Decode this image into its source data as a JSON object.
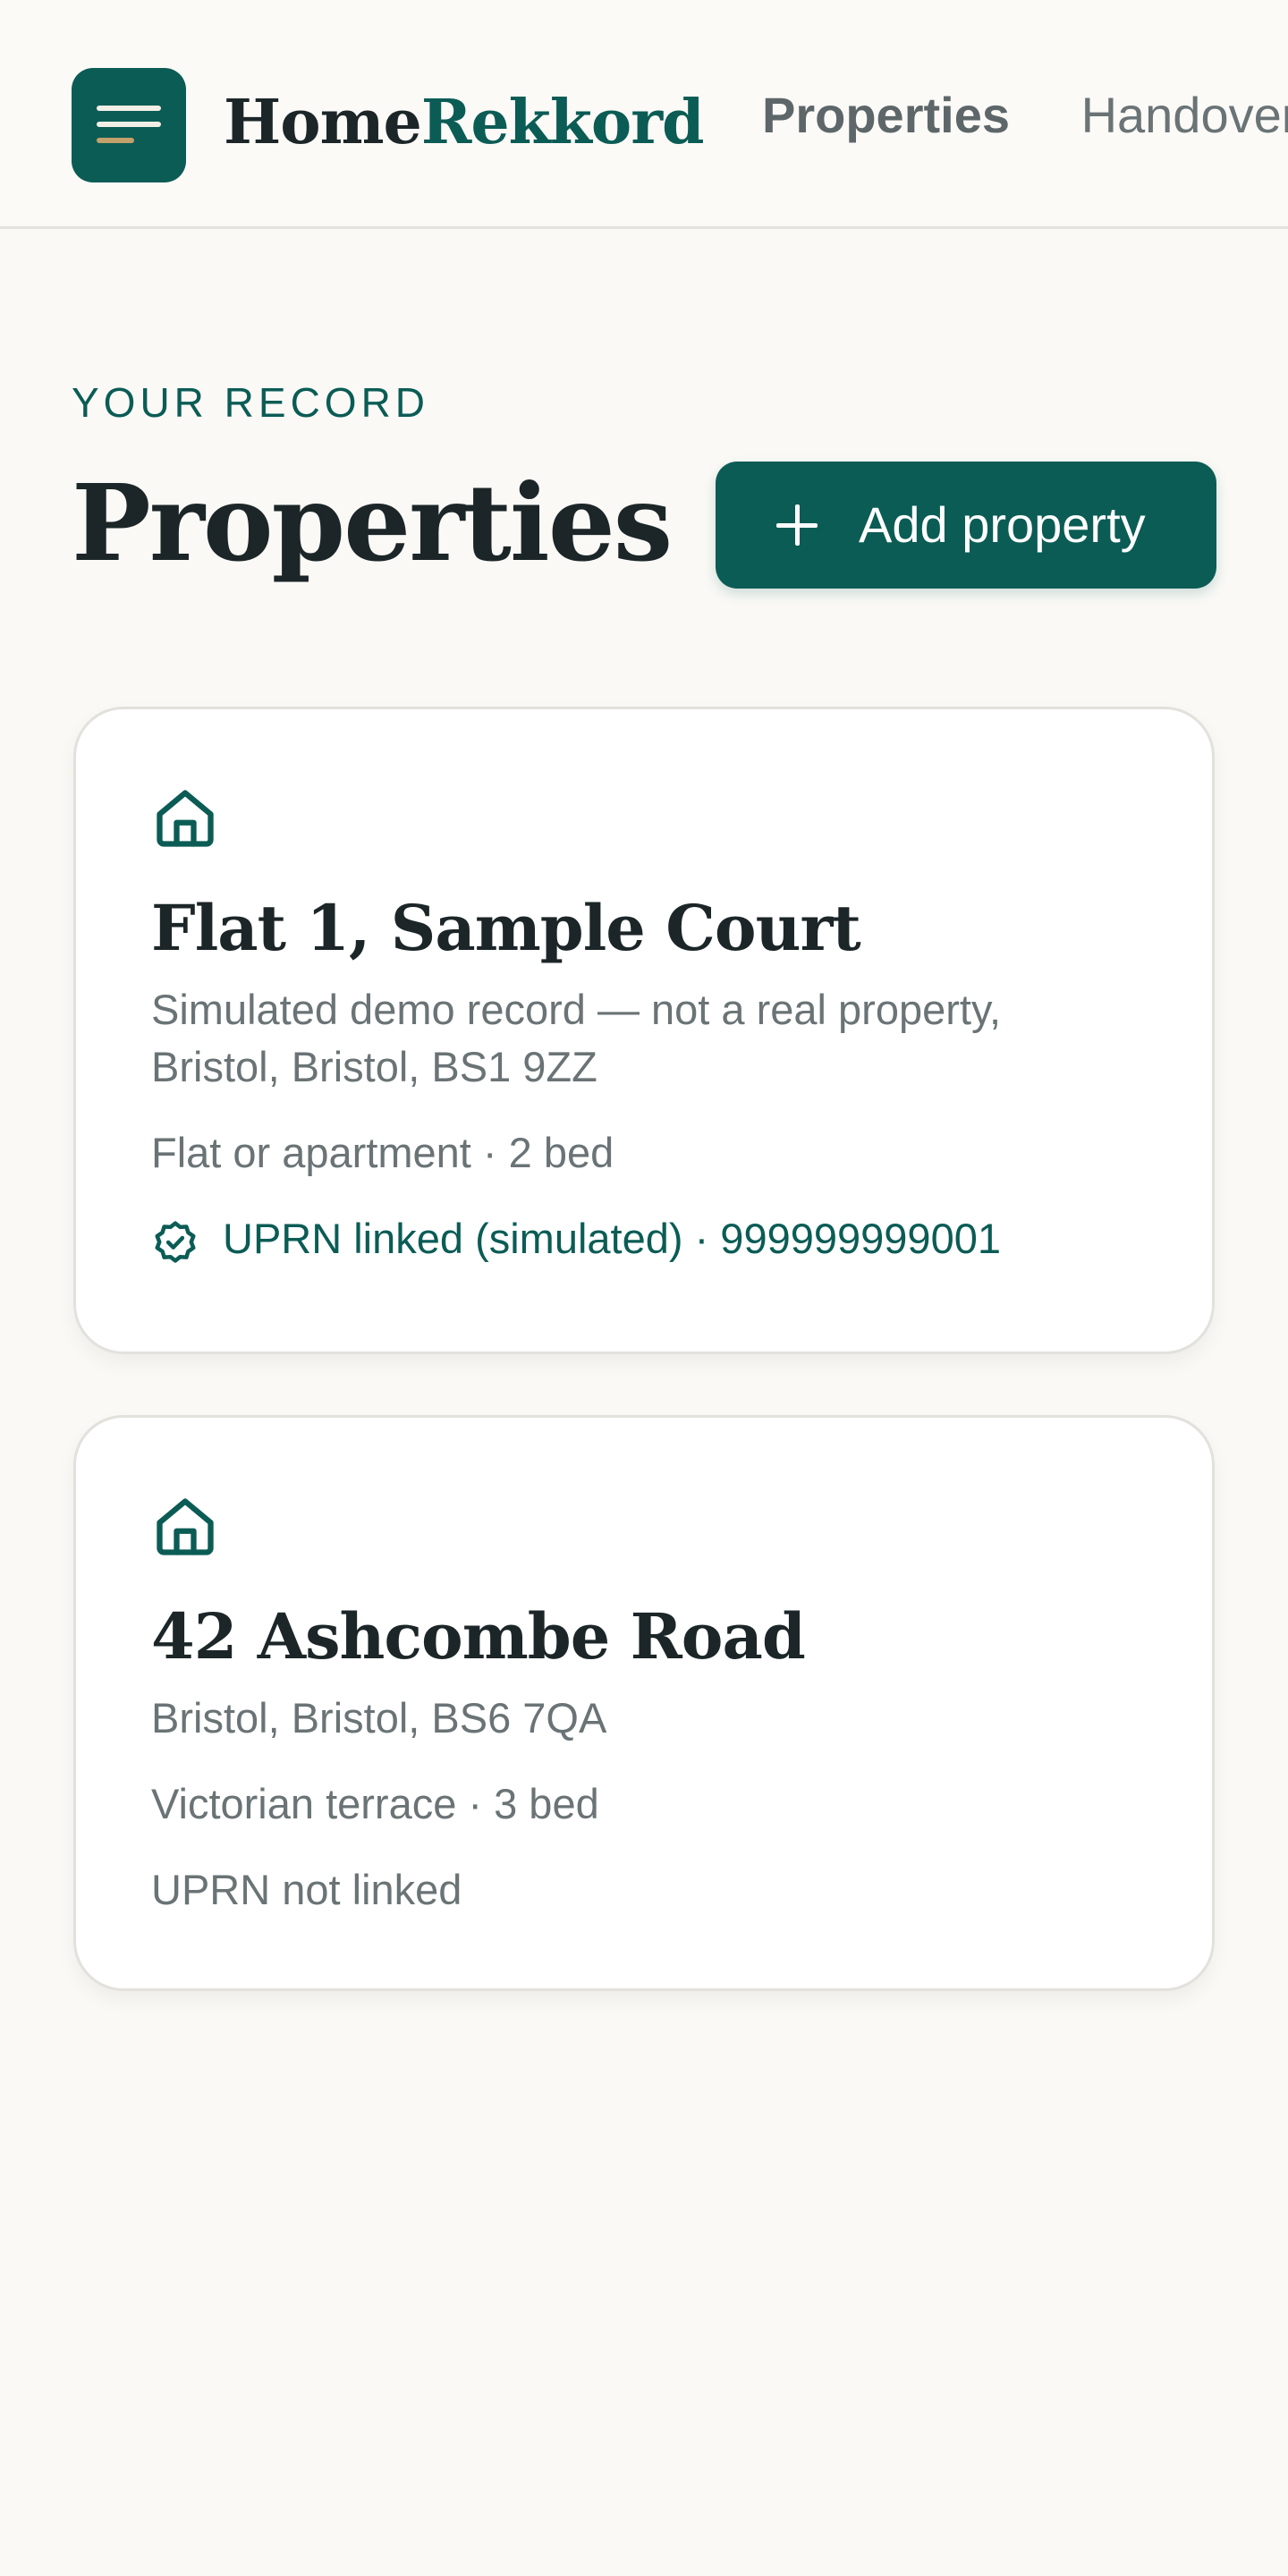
{
  "brand": {
    "name_part1": "Home",
    "name_part2": "Rekkord",
    "menu_icon": "menu-icon"
  },
  "nav": {
    "items": [
      {
        "label": "Properties",
        "active": true
      },
      {
        "label": "Handovers",
        "active": false
      }
    ]
  },
  "page": {
    "eyebrow": "YOUR RECORD",
    "title": "Properties",
    "add_button_label": "Add property",
    "add_button_icon": "plus-icon"
  },
  "properties": [
    {
      "icon": "house-icon",
      "name": "Flat 1, Sample Court",
      "address_line1": "Simulated demo record — not a real property,",
      "address_line2": "Bristol, Bristol, BS1 9ZZ",
      "details": "Flat or apartment · 2 bed",
      "uprn_status": "UPRN linked (simulated) · 999999999001",
      "uprn_icon": "check-badge-icon"
    },
    {
      "icon": "house-icon",
      "name": "42 Ashcombe Road",
      "address_line1": "Bristol, Bristol, BS6 7QA",
      "details": "Victorian terrace · 3 bed",
      "uprn_status": "UPRN not linked"
    }
  ],
  "colors": {
    "accent": "#0b5c55",
    "background": "#faf9f6",
    "text": "#1c2628",
    "muted_text": "#6a7375",
    "card_border": "#e3e1dc",
    "logo_highlight": "#c4a06a"
  }
}
